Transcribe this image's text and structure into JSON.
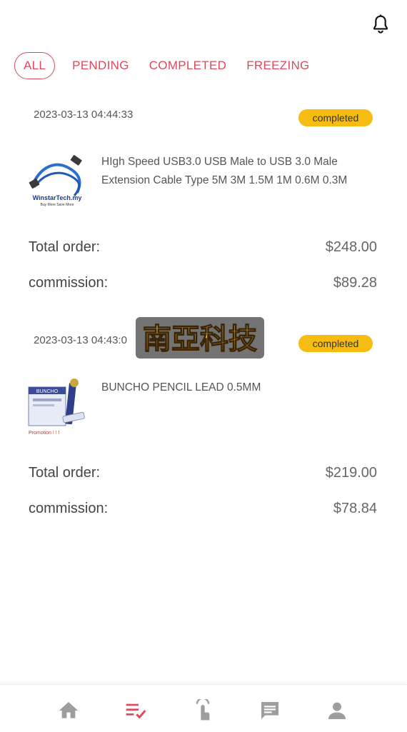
{
  "header": {
    "bell_icon": "bell-icon"
  },
  "tabs": [
    {
      "label": "ALL",
      "active": true
    },
    {
      "label": "PENDING",
      "active": false
    },
    {
      "label": "COMPLETED",
      "active": false
    },
    {
      "label": "FREEZING",
      "active": false
    }
  ],
  "orders": [
    {
      "date": "2023-03-13 04:44:33",
      "status": "completed",
      "product_name": "HIgh Speed USB3.0 USB Male to USB 3.0 Male Extension Cable Type 5M 3M 1.5M 1M 0.6M 0.3M",
      "thumb_caption": "WinstarTech.my",
      "thumb_subcaption": "Buy More Save More",
      "total_label": "Total order:",
      "total_value": "$248.00",
      "commission_label": "commission:",
      "commission_value": "$89.28"
    },
    {
      "date": "2023-03-13 04:43:0",
      "status": "completed",
      "product_name": "BUNCHO PENCIL LEAD 0.5MM",
      "thumb_caption": "BUNCHO",
      "thumb_subcaption": "Promotion ! ! !",
      "total_label": "Total order:",
      "total_value": "$219.00",
      "commission_label": "commission:",
      "commission_value": "$78.84"
    }
  ],
  "watermark": {
    "text": "南亞科技"
  },
  "colors": {
    "accent": "#e0485c",
    "badge": "#f7bc12",
    "nav_active": "#e0485c",
    "nav_inactive": "#9e9e9e"
  },
  "bottom_nav": [
    {
      "icon": "home-icon",
      "active": false
    },
    {
      "icon": "order-list-icon",
      "active": true
    },
    {
      "icon": "tap-icon",
      "active": false
    },
    {
      "icon": "chat-icon",
      "active": false
    },
    {
      "icon": "person-icon",
      "active": false
    }
  ]
}
